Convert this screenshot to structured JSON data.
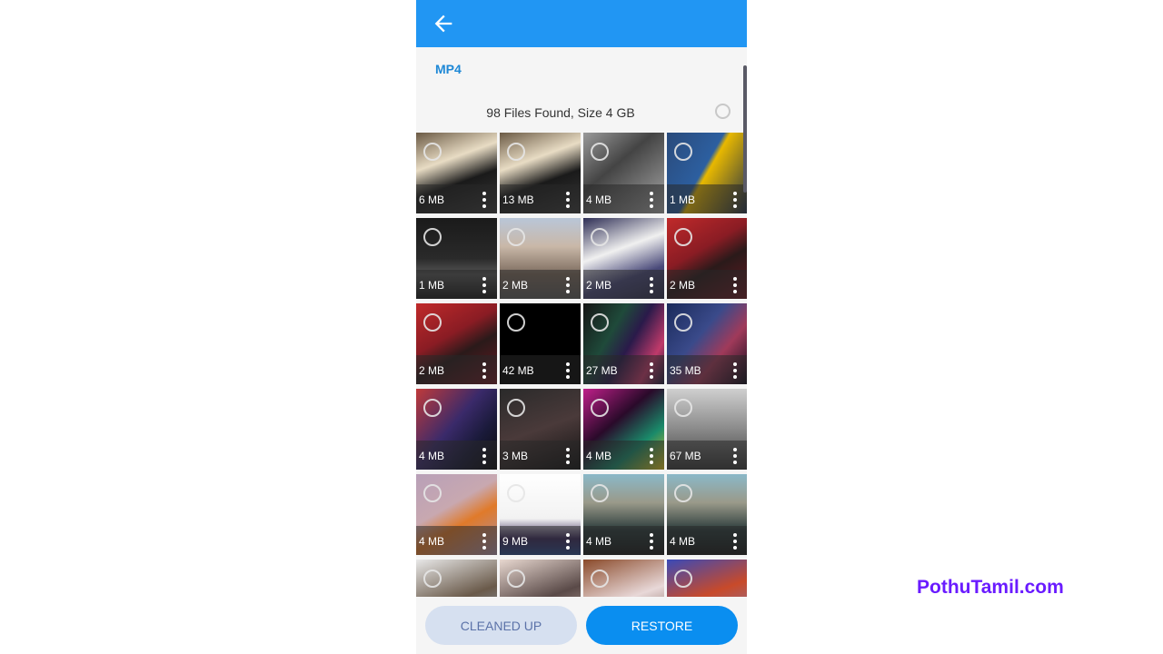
{
  "header": {
    "back_icon": "arrow-left-icon"
  },
  "section": {
    "title": "MP4"
  },
  "summary": {
    "text": "98 Files Found, Size 4 GB",
    "select_all_icon": "circle-checkbox-icon"
  },
  "files": [
    {
      "size": "6 MB",
      "bg": "linear-gradient(160deg,#6b5a45 0%,#e8dcc4 35%,#1a1a1a 60%,#3a3a3a 100%)"
    },
    {
      "size": "13 MB",
      "bg": "linear-gradient(160deg,#6b5a45 0%,#e8dcc4 35%,#1a1a1a 60%,#3a3a3a 100%)"
    },
    {
      "size": "4 MB",
      "bg": "linear-gradient(140deg,#9a9a9a 0%,#444 40%,#777 70%,#aaa 100%)"
    },
    {
      "size": "1 MB",
      "bg": "linear-gradient(120deg,#2a4a7a 0%,#2c5fa0 45%,#e8b800 50%,#1c2c4a 100%)"
    },
    {
      "size": "1 MB",
      "bg": "linear-gradient(180deg,#1a1a1a 0%,#2a2a2a 50%,#555 70%,#1a1a1a 100%)"
    },
    {
      "size": "2 MB",
      "bg": "linear-gradient(180deg,#b9c6d8 0%,#c9b8a8 35%,#7c6b5e 70%,#5a5a5a 100%)"
    },
    {
      "size": "2 MB",
      "bg": "linear-gradient(160deg,#2e2e55 0%,#f0f0f0 40%,#4a4a7a 70%,#2e2e4a 100%)"
    },
    {
      "size": "2 MB",
      "bg": "linear-gradient(150deg,#c02a2a 0%,#8a1c24 40%,#2a1a1a 60%,#6a1822 100%)"
    },
    {
      "size": "2 MB",
      "bg": "linear-gradient(150deg,#c02a2a 0%,#8a1c24 40%,#2a1a1a 60%,#6a1822 100%)"
    },
    {
      "size": "42 MB",
      "bg": "#000000"
    },
    {
      "size": "27 MB",
      "bg": "linear-gradient(120deg,#151515 0%,#1f4a3a 35%,#2a1a4a 55%,#c03a6a 80%,#1a1a3a 100%)"
    },
    {
      "size": "35 MB",
      "bg": "linear-gradient(130deg,#1a2a5a 0%,#3a4a8a 40%,#a03a5a 65%,#0a0a1a 100%)"
    },
    {
      "size": "4 MB",
      "bg": "linear-gradient(130deg,#c03a3a 0%,#3a2a6a 45%,#1a1a3a 70%,#0a0a0a 100%)"
    },
    {
      "size": "3 MB",
      "bg": "linear-gradient(160deg,#2a2a2a 0%,#4a3a3a 50%,#111 100%)"
    },
    {
      "size": "4 MB",
      "bg": "linear-gradient(140deg,#c0208a 0%,#2a0a2a 40%,#1a8a6a 70%,#e0c020 100%)"
    },
    {
      "size": "67 MB",
      "bg": "linear-gradient(180deg,#cfcfcf 0%,#8a8a8a 50%,#3a3a3a 100%)"
    },
    {
      "size": "4 MB",
      "bg": "linear-gradient(150deg,#b8a0b8 0%,#c8a8b0 40%,#e07a2a 60%,#a890a8 100%)"
    },
    {
      "size": "9 MB",
      "bg": "linear-gradient(180deg,#ffffff 0%,#f2f2f2 55%,#3a2a5a 80%,#2a4a8a 100%)"
    },
    {
      "size": "4 MB",
      "bg": "linear-gradient(180deg,#8ab8c8 0%,#9a9a8a 35%,#2a3a3a 70%,#1a1a1a 100%)"
    },
    {
      "size": "4 MB",
      "bg": "linear-gradient(180deg,#8ab8c8 0%,#9a9a8a 35%,#2a3a3a 70%,#1a1a1a 100%)"
    },
    {
      "size": "",
      "bg": "linear-gradient(160deg,#e8e8e8 0%,#6a5a4a 50%,#9ab8d8 100%)"
    },
    {
      "size": "",
      "bg": "linear-gradient(160deg,#e8d8d0 0%,#5a4a48 50%,#d8c0b8 100%)"
    },
    {
      "size": "",
      "bg": "linear-gradient(160deg,#8a4a2a 0%,#e8d8d8 50%,#5a3a2a 100%)"
    },
    {
      "size": "",
      "bg": "linear-gradient(160deg,#3a4ab8 0%,#c84a2a 45%,#6a8ad8 100%)"
    }
  ],
  "actions": {
    "cleaned_up": "CLEANED UP",
    "restore": "RESTORE"
  },
  "watermark": "PothuTamil.com",
  "colors": {
    "appbar": "#2196f3",
    "accent": "#0a8ef0",
    "brand": "#6a1bff"
  }
}
